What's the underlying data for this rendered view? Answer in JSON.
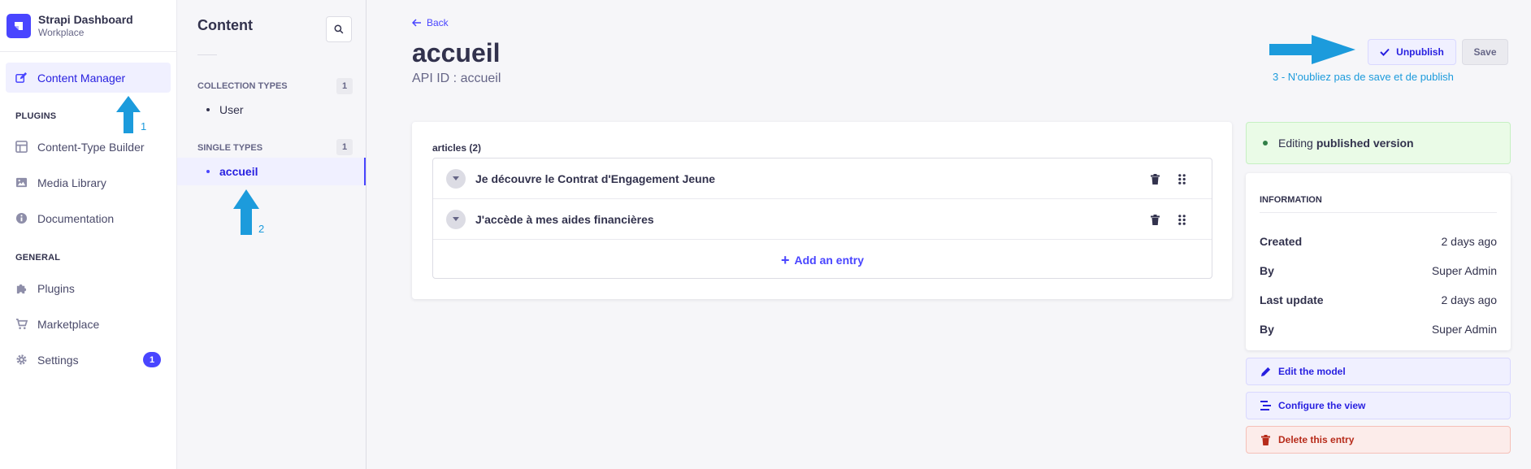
{
  "brand": {
    "title": "Strapi Dashboard",
    "subtitle": "Workplace"
  },
  "nav": {
    "content_manager": "Content Manager",
    "plugins_section": "PLUGINS",
    "content_type_builder": "Content-Type Builder",
    "media_library": "Media Library",
    "documentation": "Documentation",
    "general_section": "GENERAL",
    "plugins": "Plugins",
    "marketplace": "Marketplace",
    "settings": "Settings",
    "settings_badge": "1"
  },
  "subnav": {
    "title": "Content",
    "collection_types_label": "COLLECTION TYPES",
    "collection_types_count": "1",
    "collection_items": [
      "User"
    ],
    "single_types_label": "SINGLE TYPES",
    "single_types_count": "1",
    "single_items": [
      "accueil"
    ]
  },
  "header": {
    "back": "Back",
    "title": "accueil",
    "api_id": "API ID : accueil",
    "unpublish": "Unpublish",
    "save": "Save"
  },
  "annotations": {
    "hint": "3 - N'oubliez pas de save et de publish",
    "n1": "1",
    "n2": "2"
  },
  "editor": {
    "field_label": "articles (2)",
    "rows": [
      "Je découvre le Contrat d'Engagement Jeune",
      "J'accède à mes aides financières"
    ],
    "add_entry": "Add an entry"
  },
  "status": {
    "prefix": "Editing",
    "bold": "published version"
  },
  "information": {
    "title": "INFORMATION",
    "rows": [
      {
        "key": "Created",
        "value": "2 days ago"
      },
      {
        "key": "By",
        "value": "Super Admin"
      },
      {
        "key": "Last update",
        "value": "2 days ago"
      },
      {
        "key": "By",
        "value": "Super Admin"
      }
    ]
  },
  "actions": {
    "edit_model": "Edit the model",
    "configure_view": "Configure the view",
    "delete_entry": "Delete this entry"
  },
  "colors": {
    "primary": "#4945ff",
    "annotation": "#1c9bdc",
    "success": "#328048",
    "danger": "#b72b1a"
  }
}
